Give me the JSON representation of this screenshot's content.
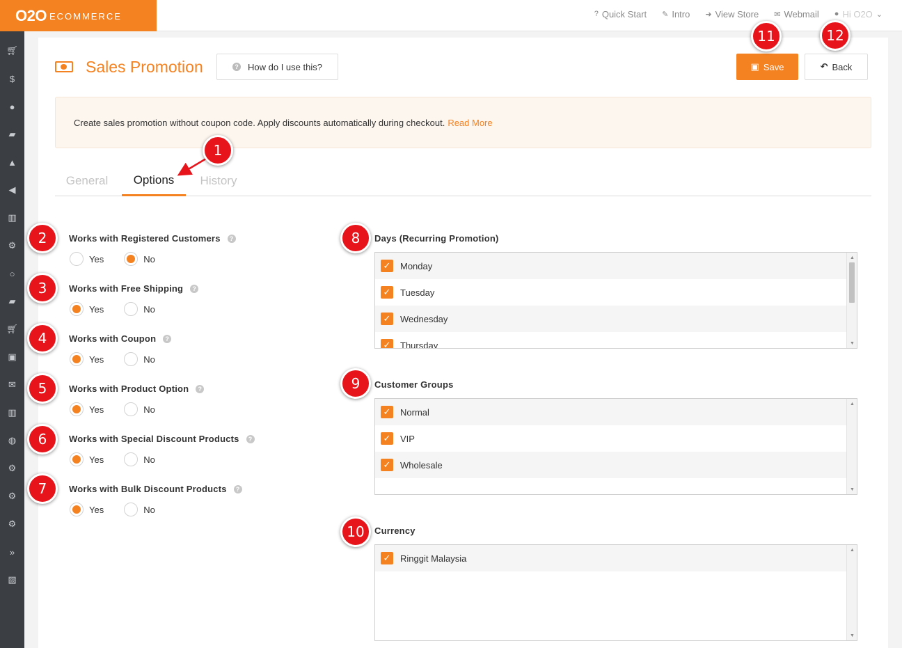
{
  "brand": {
    "logo_mark": "O2O",
    "logo_text": "ECOMMERCE"
  },
  "topnav": {
    "quick_start": "Quick Start",
    "intro": "Intro",
    "view_store": "View Store",
    "webmail": "Webmail",
    "user": "Hi O2O"
  },
  "header": {
    "title": "Sales Promotion",
    "howto": "How do I use this?",
    "save": "Save",
    "back": "Back"
  },
  "notice": {
    "text": "Create sales promotion without coupon code. Apply discounts automatically during checkout.",
    "link": "Read More"
  },
  "tabs": [
    "General",
    "Options",
    "History"
  ],
  "options": [
    {
      "label": "Works with Registered Customers",
      "yes": "Yes",
      "no": "No",
      "selected": "no"
    },
    {
      "label": "Works with Free Shipping",
      "yes": "Yes",
      "no": "No",
      "selected": "yes"
    },
    {
      "label": "Works with Coupon",
      "yes": "Yes",
      "no": "No",
      "selected": "yes"
    },
    {
      "label": "Works with Product Option",
      "yes": "Yes",
      "no": "No",
      "selected": "yes"
    },
    {
      "label": "Works with Special Discount Products",
      "yes": "Yes",
      "no": "No",
      "selected": "yes"
    },
    {
      "label": "Works with Bulk Discount Products",
      "yes": "Yes",
      "no": "No",
      "selected": "yes"
    }
  ],
  "days": {
    "label": "Days (Recurring Promotion)",
    "items": [
      "Monday",
      "Tuesday",
      "Wednesday",
      "Thursday"
    ]
  },
  "customer_groups": {
    "label": "Customer Groups",
    "items": [
      "Normal",
      "VIP",
      "Wholesale"
    ]
  },
  "currency": {
    "label": "Currency",
    "items": [
      "Ringgit Malaysia"
    ]
  },
  "markers": [
    "1",
    "2",
    "3",
    "4",
    "5",
    "6",
    "7",
    "8",
    "9",
    "10",
    "11",
    "12"
  ],
  "colors": {
    "accent": "#f58220",
    "sidebar": "#3b3f44",
    "marker": "#e8141b"
  }
}
